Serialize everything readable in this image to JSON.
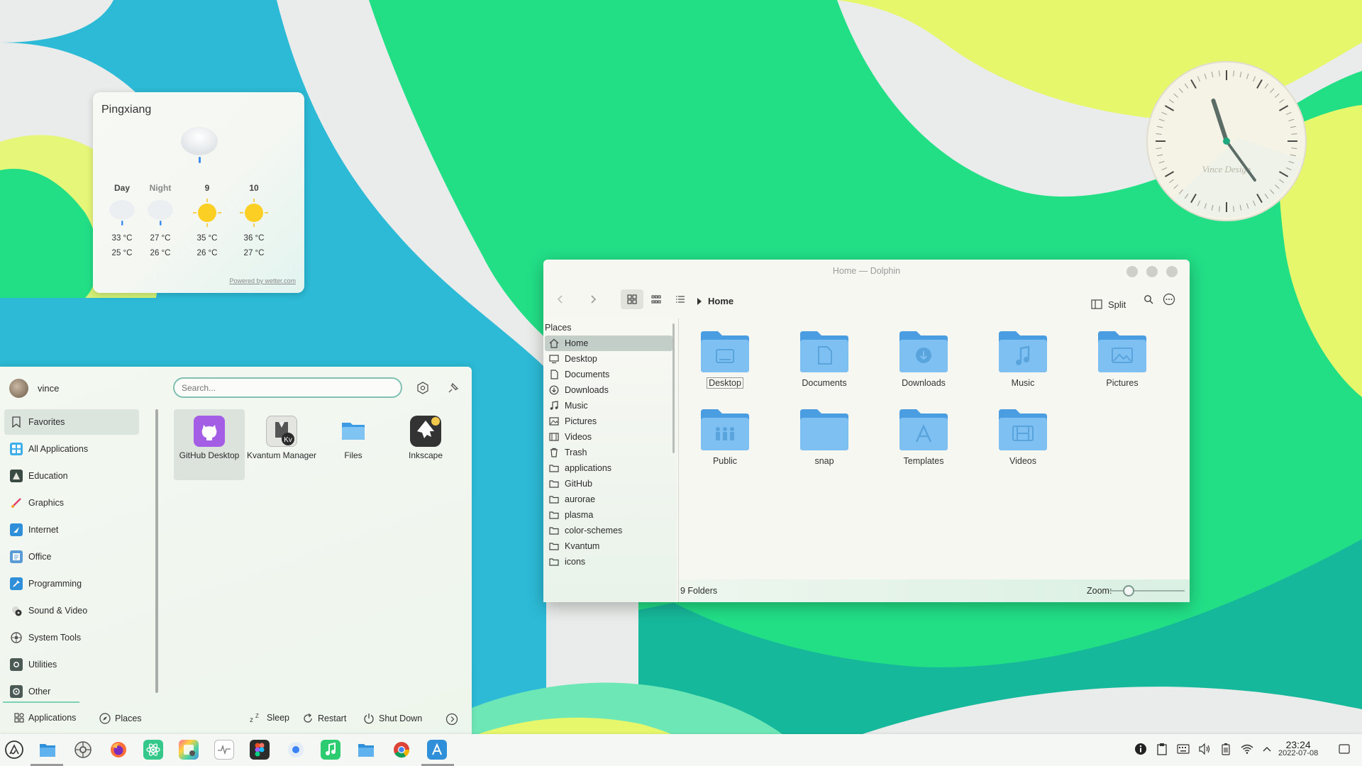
{
  "colors": {
    "accent": "#3daee9",
    "folder": "#5aa9e6",
    "wallpaper_green": "#22df86",
    "wallpaper_cyan": "#2cbad6",
    "wallpaper_yellow": "#e6f76c",
    "wallpaper_teal": "#16b89b"
  },
  "weather": {
    "city": "Pingxiang",
    "powered": "Powered by wetter.com",
    "forecast": [
      {
        "label": "Day",
        "icon": "cloud-rain-icon",
        "high": "33 °C",
        "low": "25 °C"
      },
      {
        "label": "Night",
        "icon": "cloud-rain-icon",
        "high": "27 °C",
        "low": "26 °C"
      },
      {
        "label": "9",
        "icon": "sun-icon",
        "high": "35 °C",
        "low": "26 °C"
      },
      {
        "label": "10",
        "icon": "sun-icon",
        "high": "36 °C",
        "low": "27 °C"
      }
    ]
  },
  "clock_widget": {
    "brand": "Vince Design",
    "hour": 11,
    "minute": 24
  },
  "dolphin": {
    "title": "Home — Dolphin",
    "breadcrumb": "Home",
    "split_label": "Split",
    "places_header": "Places",
    "places": [
      {
        "label": "Home",
        "icon": "home-icon"
      },
      {
        "label": "Desktop",
        "icon": "desktop-icon"
      },
      {
        "label": "Documents",
        "icon": "documents-icon"
      },
      {
        "label": "Downloads",
        "icon": "downloads-icon"
      },
      {
        "label": "Music",
        "icon": "music-icon"
      },
      {
        "label": "Pictures",
        "icon": "pictures-icon"
      },
      {
        "label": "Videos",
        "icon": "videos-icon"
      },
      {
        "label": "Trash",
        "icon": "trash-icon"
      },
      {
        "label": "applications",
        "icon": "folder-icon"
      },
      {
        "label": "GitHub",
        "icon": "folder-icon"
      },
      {
        "label": "aurorae",
        "icon": "folder-icon"
      },
      {
        "label": "plasma",
        "icon": "folder-icon"
      },
      {
        "label": "color-schemes",
        "icon": "folder-icon"
      },
      {
        "label": "Kvantum",
        "icon": "folder-icon"
      },
      {
        "label": "icons",
        "icon": "folder-icon"
      }
    ],
    "folders": [
      {
        "label": "Desktop",
        "emblem": "desktop"
      },
      {
        "label": "Documents",
        "emblem": "documents"
      },
      {
        "label": "Downloads",
        "emblem": "downloads"
      },
      {
        "label": "Music",
        "emblem": "music"
      },
      {
        "label": "Pictures",
        "emblem": "pictures"
      },
      {
        "label": "Public",
        "emblem": "public"
      },
      {
        "label": "snap",
        "emblem": "none"
      },
      {
        "label": "Templates",
        "emblem": "templates"
      },
      {
        "label": "Videos",
        "emblem": "videos"
      }
    ],
    "status": "9 Folders",
    "zoom_label": "Zoom:",
    "zoom_level": 0.25
  },
  "launcher": {
    "user": "vince",
    "search_placeholder": "Search...",
    "categories": [
      {
        "label": "Favorites",
        "icon": "bookmark-icon"
      },
      {
        "label": "All Applications",
        "icon": "grid-icon"
      },
      {
        "label": "Education",
        "icon": "education-icon"
      },
      {
        "label": "Graphics",
        "icon": "graphics-icon"
      },
      {
        "label": "Internet",
        "icon": "internet-icon"
      },
      {
        "label": "Office",
        "icon": "office-icon"
      },
      {
        "label": "Programming",
        "icon": "programming-icon"
      },
      {
        "label": "Sound & Video",
        "icon": "sound-video-icon"
      },
      {
        "label": "System Tools",
        "icon": "system-tools-icon"
      },
      {
        "label": "Utilities",
        "icon": "utilities-icon"
      },
      {
        "label": "Other",
        "icon": "other-icon"
      }
    ],
    "apps": [
      {
        "label": "GitHub Desktop",
        "icon": "github-desktop-icon"
      },
      {
        "label": "Kvantum Manager",
        "icon": "kvantum-icon"
      },
      {
        "label": "Files",
        "icon": "files-icon"
      },
      {
        "label": "Inkscape",
        "icon": "inkscape-icon"
      }
    ],
    "footer": {
      "applications": "Applications",
      "places": "Places",
      "sleep": "Sleep",
      "restart": "Restart",
      "shutdown": "Shut Down"
    }
  },
  "taskbar": {
    "apps": [
      "launcher-icon",
      "dolphin-icon",
      "system-settings-icon",
      "firefox-icon",
      "atom-icon",
      "color-picker-icon",
      "system-monitor-icon",
      "figma-icon",
      "chromium-icon",
      "music-app-icon",
      "files-app-icon",
      "chrome-icon",
      "discover-icon"
    ],
    "time": "23:24",
    "date": "2022-07-08"
  }
}
